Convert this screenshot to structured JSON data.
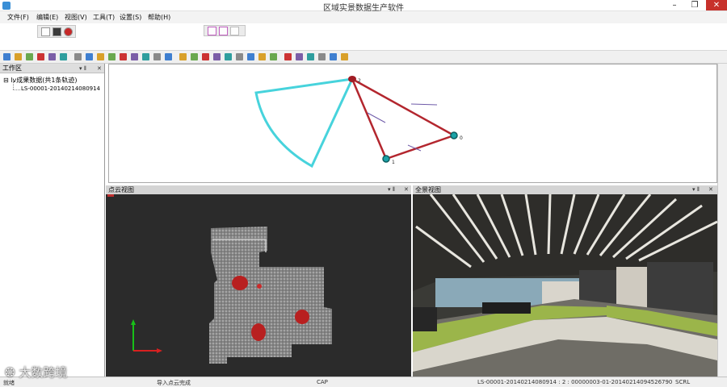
{
  "window": {
    "title": "区域实景数据生产软件",
    "controls": {
      "minimize": "–",
      "restore": "❐",
      "close": "✕"
    }
  },
  "menu": [
    "文件(F)",
    "编辑(E)",
    "视图(V)",
    "工具(T)",
    "设置(S)",
    "帮助(H)"
  ],
  "toolbar_icons": [
    "new-icon",
    "open-icon",
    "save-icon",
    "undo-icon",
    "redo-icon",
    "help-icon",
    "add-icon",
    "select-icon",
    "delete-icon",
    "edit-icon",
    "cut-icon",
    "copy-icon",
    "zoom-in-icon",
    "zoom-out-icon",
    "pan-icon",
    "rect-icon",
    "pencil-icon",
    "grid-icon",
    "measure-icon",
    "layer-icon",
    "point-icon",
    "frame-icon",
    "color-icon",
    "export-icon",
    "pointer-icon",
    "g-icon",
    "arrow-left-icon",
    "arrow-right-icon",
    "link-icon",
    "tag-icon"
  ],
  "workspace": {
    "title": "工作区",
    "tree_root": "lv成果数据(共1条轨迹)",
    "tree_child": "LS-00001-20140214080914"
  },
  "trajectory": {
    "node_labels": [
      "2",
      "1",
      "0"
    ]
  },
  "pointcloud_view": {
    "title": "点云视图"
  },
  "panorama_view": {
    "title": "全景视图"
  },
  "status": {
    "ready": "就绪",
    "message": "导入点云完成",
    "cap": "CAP",
    "frame_info": "LS-00001-20140214080914 : 2 : 00000003-01-20140214094526790",
    "scroll": "SCRL"
  },
  "watermark": "大数跨境",
  "colors": {
    "trajectory_line": "#b3262e",
    "view_fan": "#47d3dc",
    "node_fill": "#1aa3a8",
    "axis_y": "#18c018",
    "axis_x": "#d82020"
  }
}
